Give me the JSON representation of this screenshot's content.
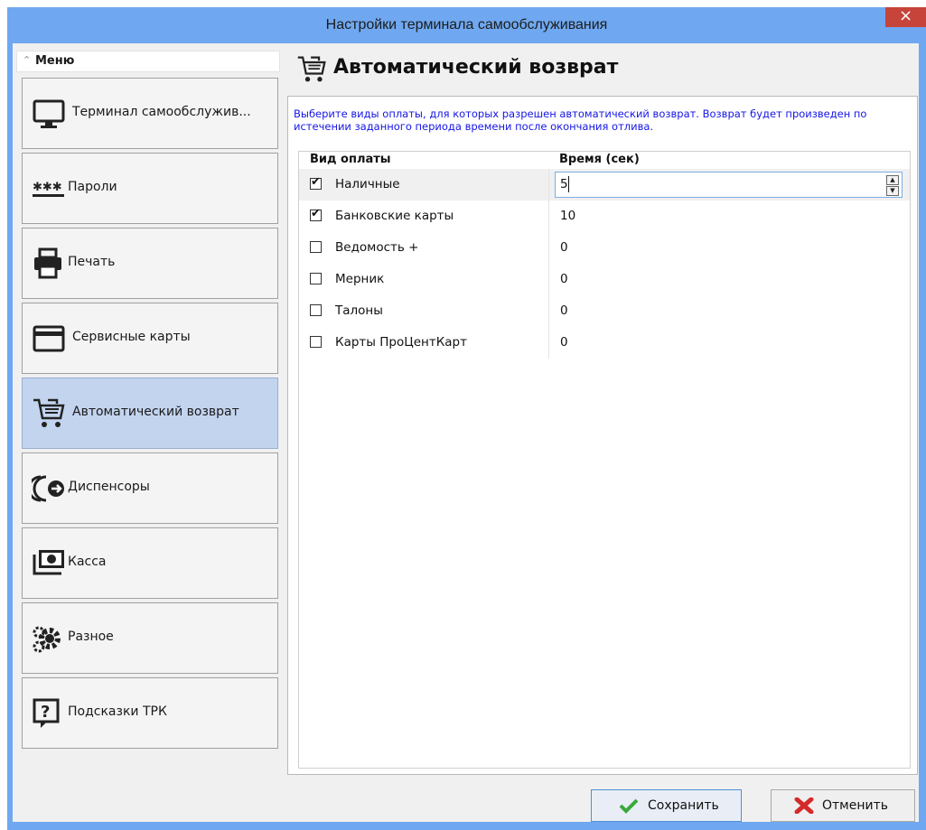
{
  "window": {
    "title": "Настройки терминала самообслуживания",
    "close_glyph": "×"
  },
  "sidebar": {
    "header": "Меню",
    "header_chevron": "chevron-up-icon",
    "items": [
      {
        "label": "Терминал самообслужив...",
        "icon": "monitor-icon"
      },
      {
        "label": "Пароли",
        "icon": "password-icon"
      },
      {
        "label": "Печать",
        "icon": "printer-icon"
      },
      {
        "label": "Сервисные карты",
        "icon": "card-icon"
      },
      {
        "label": "Автоматический возврат",
        "icon": "cart-return-icon",
        "active": true
      },
      {
        "label": "Диспенсоры",
        "icon": "dispenser-icon"
      },
      {
        "label": "Касса",
        "icon": "cash-icon"
      },
      {
        "label": "Разное",
        "icon": "gears-icon"
      },
      {
        "label": "Подсказки ТРК",
        "icon": "help-icon"
      }
    ]
  },
  "panel": {
    "title": "Автоматический возврат",
    "icon": "cart-return-icon",
    "description": "Выберите виды оплаты, для которых разрешен автоматический возврат. Возврат будет произведен по истечении заданного периода времени после окончания отлива.",
    "columns": [
      "Вид оплаты",
      "Время (сек)"
    ],
    "rows": [
      {
        "name": "Наличные",
        "checked": true,
        "time": "5",
        "editing": true
      },
      {
        "name": "Банковские карты",
        "checked": true,
        "time": "10"
      },
      {
        "name": "Ведомость +",
        "checked": false,
        "time": "0"
      },
      {
        "name": "Мерник",
        "checked": false,
        "time": "0"
      },
      {
        "name": "Талоны",
        "checked": false,
        "time": "0"
      },
      {
        "name": "Карты ПроЦентКарт",
        "checked": false,
        "time": "0"
      }
    ],
    "check_glyph": "✔"
  },
  "buttons": {
    "save_label": "Сохранить",
    "cancel_label": "Отменить"
  },
  "colors": {
    "titlebar": "#6fa8f0",
    "close": "#c7443a",
    "active_item": "#c3d4ef",
    "description": "#1515e8",
    "save_icon": "#3aa83a",
    "cancel_icon": "#d42a2a"
  }
}
